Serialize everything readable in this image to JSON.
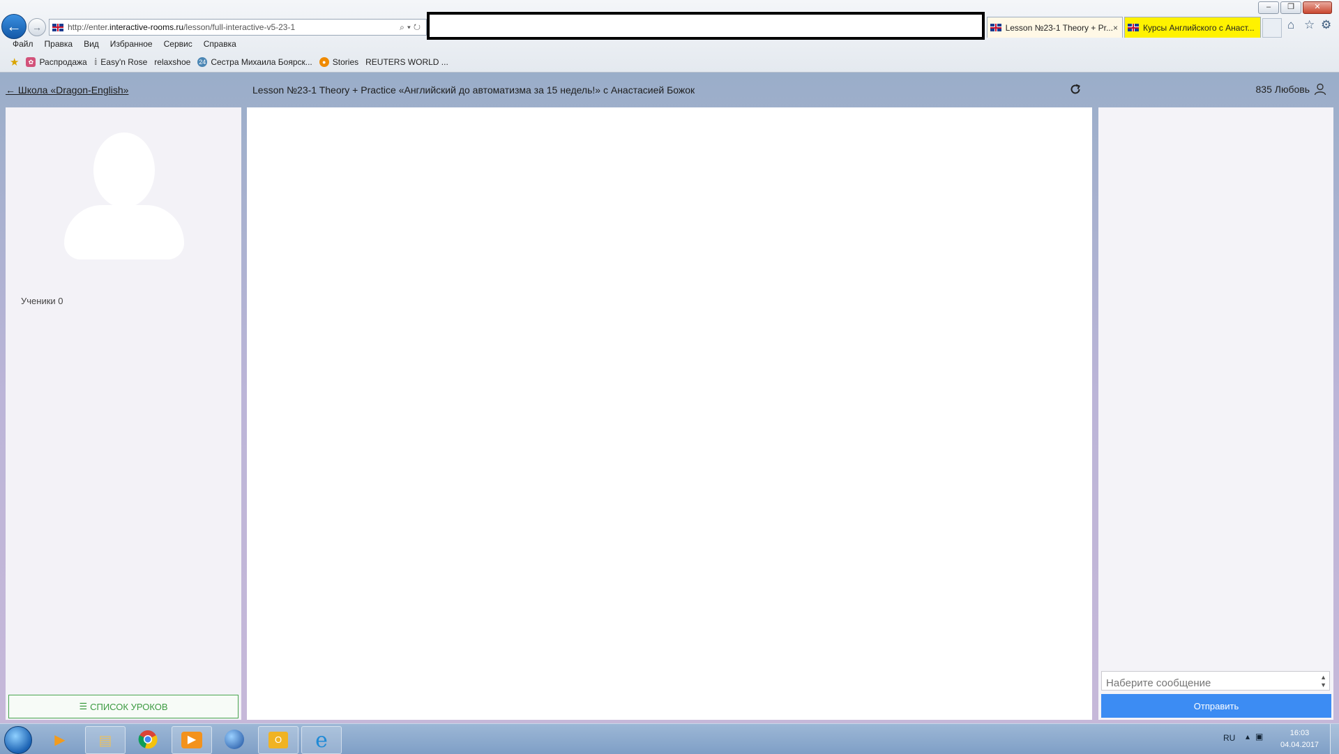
{
  "browser": {
    "address_bar": {
      "url_prefix": "http://enter.",
      "url_domain": "interactive-rooms.ru",
      "url_path": "/lesson/full-interactive-v5-23-1"
    },
    "tabs": [
      {
        "label": "Lesson №23-1 Theory + Pr...",
        "close": "×"
      },
      {
        "label": "Курсы Английского с Анаст..."
      }
    ],
    "menu": [
      "Файл",
      "Правка",
      "Вид",
      "Избранное",
      "Сервис",
      "Справка"
    ],
    "favorites": [
      {
        "label": "Распродажа",
        "icon": "flower-icon",
        "color": "#d2527a"
      },
      {
        "label": "Easy'n Rose",
        "icon": "letter-icon",
        "color": "#555555"
      },
      {
        "label": "relaxshoe",
        "icon": "",
        "color": ""
      },
      {
        "label": "Сестра Михаила Боярск...",
        "icon": "news24-icon",
        "color": "#4b86b4"
      },
      {
        "label": "Stories",
        "icon": "reuters-icon",
        "color": "#ef8a00"
      },
      {
        "label": "REUTERS WORLD ...",
        "icon": "",
        "color": ""
      }
    ],
    "window_buttons": {
      "minimize": "–",
      "restore": "❐",
      "close": "✕"
    }
  },
  "page": {
    "back_link": "← Школа «Dragon-English»",
    "lesson_title": "Lesson №23-1 Theory + Practice «Английский до автоматизма за 15 недель!» с Анастасией Божок",
    "user": {
      "name": "835 Любовь"
    },
    "left_panel": {
      "students_label": "Ученики 0",
      "lessons_list_button": "СПИСОК УРОКОВ"
    },
    "chat": {
      "placeholder": "Наберите сообщение",
      "send_label": "Отправить"
    }
  },
  "taskbar": {
    "language": "RU",
    "time": "16:03",
    "date": "04.04.2017",
    "apps": [
      "media-player-icon",
      "file-explorer-icon",
      "chrome-icon",
      "video-player-icon",
      "globe-icon",
      "outlook-icon",
      "internet-explorer-icon"
    ]
  },
  "colors": {
    "accent_blue": "#3c8cf3",
    "green_button": "#49a54f",
    "tab_highlight": "#fff200"
  }
}
